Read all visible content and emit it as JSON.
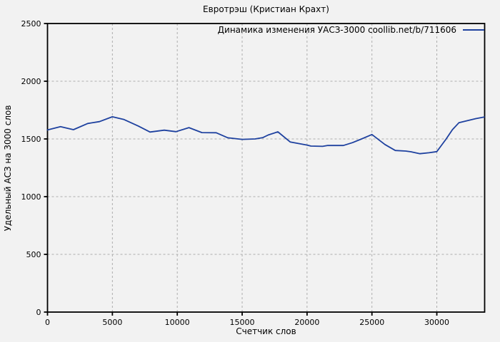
{
  "colors": {
    "background": "#f2f2f2",
    "border": "#000000",
    "grid": "#adadad",
    "series_line": "#1e419f",
    "text": "#000000"
  },
  "chart_data": {
    "type": "line",
    "title": "Евротрэш (Кристиан Крахт)",
    "xlabel": "Счетчик слов",
    "ylabel": "Удельный АСЗ на 3000 слов",
    "grid": true,
    "legend_position": "top-right-inside",
    "xlim": [
      0,
      33685
    ],
    "ylim": [
      0,
      2500
    ],
    "xticks": [
      0,
      5000,
      10000,
      15000,
      20000,
      25000,
      30000
    ],
    "yticks": [
      0,
      500,
      1000,
      1500,
      2000,
      2500
    ],
    "series": [
      {
        "name": "Динамика изменения УАСЗ-3000 coollib.net/b/711606",
        "color": "#1e419f",
        "points": [
          [
            0,
            1578
          ],
          [
            1000,
            1606
          ],
          [
            2000,
            1580
          ],
          [
            3100,
            1634
          ],
          [
            4000,
            1650
          ],
          [
            5000,
            1692
          ],
          [
            5900,
            1668
          ],
          [
            7000,
            1612
          ],
          [
            7900,
            1560
          ],
          [
            9000,
            1576
          ],
          [
            9900,
            1563
          ],
          [
            10900,
            1598
          ],
          [
            11900,
            1555
          ],
          [
            13000,
            1554
          ],
          [
            13900,
            1510
          ],
          [
            15000,
            1496
          ],
          [
            16000,
            1500
          ],
          [
            16600,
            1512
          ],
          [
            17000,
            1534
          ],
          [
            17750,
            1562
          ],
          [
            18700,
            1474
          ],
          [
            20000,
            1447
          ],
          [
            20300,
            1438
          ],
          [
            21200,
            1436
          ],
          [
            21600,
            1444
          ],
          [
            22800,
            1443
          ],
          [
            23500,
            1468
          ],
          [
            24200,
            1500
          ],
          [
            25000,
            1538
          ],
          [
            26000,
            1452
          ],
          [
            26800,
            1400
          ],
          [
            27600,
            1395
          ],
          [
            28000,
            1389
          ],
          [
            28700,
            1372
          ],
          [
            29400,
            1380
          ],
          [
            30000,
            1390
          ],
          [
            30300,
            1436
          ],
          [
            30700,
            1497
          ],
          [
            31200,
            1580
          ],
          [
            31700,
            1640
          ],
          [
            32400,
            1660
          ],
          [
            33000,
            1676
          ],
          [
            33650,
            1690
          ]
        ]
      }
    ]
  }
}
